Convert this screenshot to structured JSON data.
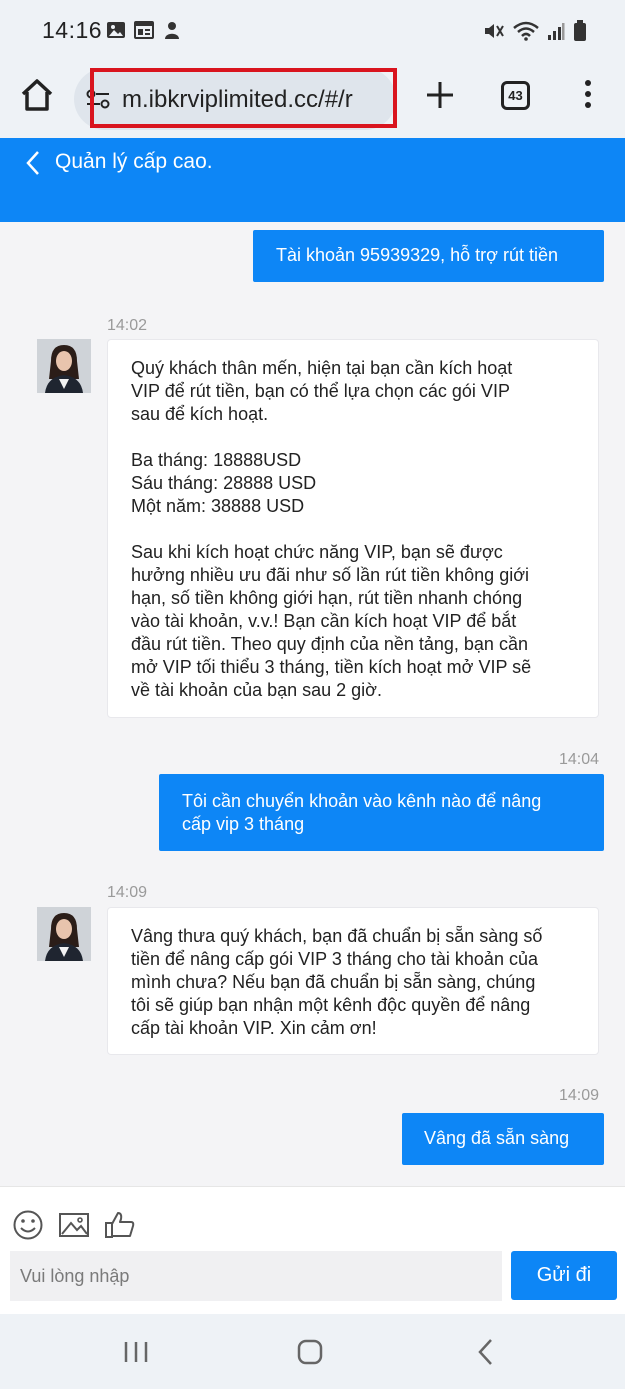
{
  "status_bar": {
    "time": "14:16",
    "left_icons": [
      "image-icon",
      "calendar-icon",
      "person-icon"
    ],
    "right_icons": [
      "mute-icon",
      "wifi-icon",
      "signal-icon",
      "battery-icon"
    ]
  },
  "browser": {
    "url": "m.ibkrviplimited.cc/#/r",
    "tab_count": "43"
  },
  "header": {
    "title": "Quản lý cấp cao."
  },
  "messages": {
    "m1": {
      "direction": "out",
      "lines": [
        "Tài khoản 95939329, hỗ trợ rút tiền"
      ]
    },
    "m2": {
      "direction": "in",
      "time": "14:02",
      "lines": [
        "Quý khách thân mến, hiện tại bạn cần kích hoạt",
        "VIP để rút tiền, bạn có thể lựa chọn các gói VIP",
        "sau để kích hoạt.",
        "",
        "Ba tháng: 18888USD",
        "Sáu tháng: 28888 USD",
        "Một năm: 38888 USD",
        "",
        "Sau khi kích hoạt chức năng VIP, bạn sẽ được",
        "hưởng nhiều ưu đãi như số lần rút tiền không giới",
        "hạn, số tiền không giới hạn, rút tiền nhanh chóng",
        "vào tài khoản, v.v.! Bạn cần kích hoạt VIP để bắt",
        "đầu rút tiền. Theo quy định của nền tảng, bạn cần",
        "mở VIP tối thiểu 3 tháng, tiền kích hoạt mở VIP sẽ",
        "về tài khoản của bạn sau 2 giờ."
      ]
    },
    "m3": {
      "direction": "out",
      "time": "14:04",
      "lines": [
        "Tôi cần chuyển khoản vào kênh nào để nâng",
        "cấp vip 3 tháng"
      ]
    },
    "m4": {
      "direction": "in",
      "time": "14:09",
      "lines": [
        "Vâng thưa quý khách, bạn đã chuẩn bị sẵn sàng số",
        "tiền để nâng cấp gói VIP 3 tháng cho tài khoản của",
        "mình chưa? Nếu bạn đã chuẩn bị sẵn sàng, chúng",
        "tôi sẽ giúp bạn nhận một kênh độc quyền để nâng",
        "cấp tài khoản VIP. Xin cảm ơn!"
      ]
    },
    "m5": {
      "direction": "out",
      "time": "14:09",
      "lines": [
        "Vâng đã sẵn sàng"
      ]
    }
  },
  "input": {
    "placeholder": "Vui lòng nhập",
    "send_label": "Gửi đi",
    "tools": [
      "emoji-icon",
      "image-icon",
      "thumbs-up-icon"
    ]
  },
  "nav": {
    "buttons": [
      "recent-apps-icon",
      "home-icon",
      "back-icon"
    ]
  },
  "colors": {
    "accent": "#0d86f6",
    "highlight_border": "#d9141e"
  }
}
